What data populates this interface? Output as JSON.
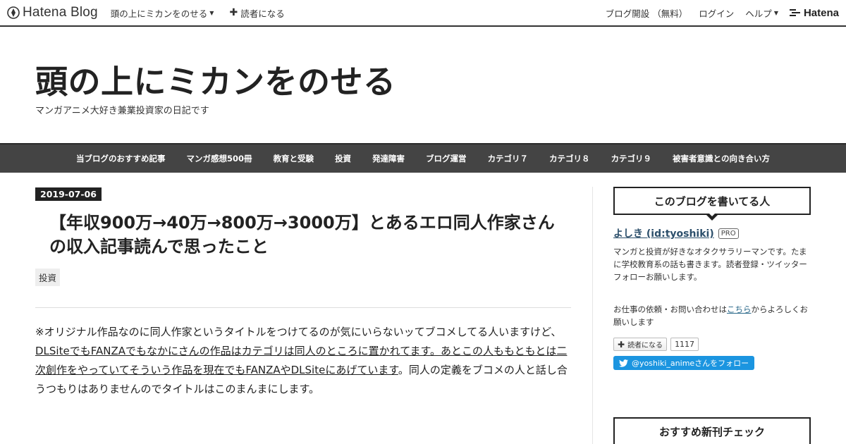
{
  "globalbar": {
    "logo_text": "Hatena Blog",
    "blog_menu_label": "頭の上にミカンをのせる",
    "subscribe_label": "読者になる",
    "open_blog_label": "ブログ開設 （無料）",
    "login_label": "ログイン",
    "help_label": "ヘルプ",
    "hatena_label": "Hatena"
  },
  "header": {
    "title": "頭の上にミカンをのせる",
    "description": "マンガアニメ大好き兼業投資家の日記です"
  },
  "nav": {
    "items": [
      "当ブログのおすすめ記事",
      "マンガ感想500冊",
      "教育と受験",
      "投資",
      "発達障害",
      "ブログ運営",
      "カテゴリ７",
      "カテゴリ８",
      "カテゴリ９",
      "被害者意識との向き合い方"
    ]
  },
  "entry": {
    "date": "2019-07-06",
    "title": "【年収900万→40万→800万→3000万】とあるエロ同人作家さんの収入記事読んで思ったこと",
    "category": "投資",
    "body_part1": "※オリジナル作品なのに同人作家というタイトルをつけてるのが気にいらないッてブコメしてる人いますけど、",
    "body_link": "DLSiteでもFANZAでもなかにさんの作品はカテゴリは同人のところに置かれてます。あとこの人ももともとは二次創作をやっていてそういう作品を現在でもFANZAやDLSiteにあげています",
    "body_part2": "。同人の定義をブコメの人と話し合うつもりはありませんのでタイトルはこのまんまにします。"
  },
  "sidebar": {
    "profile_title": "このブログを書いてる人",
    "author_name": "よしき (id:tyoshiki)",
    "pro_badge": "PRO",
    "author_desc": "マンガと投資が好きなオタクサラリーマンです。たまに学校教育系の話も書きます。読者登録・ツイッターフォローお願いします。",
    "contact_before": "お仕事の依頼・お問い合わせは",
    "contact_link": "こちら",
    "contact_after": "からよろしくお願いします",
    "subscribe_label": "読者になる",
    "subscriber_count": "1117",
    "twitter_label": "@yoshiki_animeさんをフォロー",
    "new_books_title": "おすすめ新刊チェック"
  },
  "colors": {
    "nav_bg": "#444444",
    "twitter_blue": "#1b95e0",
    "author_link": "#2c4f6b"
  }
}
